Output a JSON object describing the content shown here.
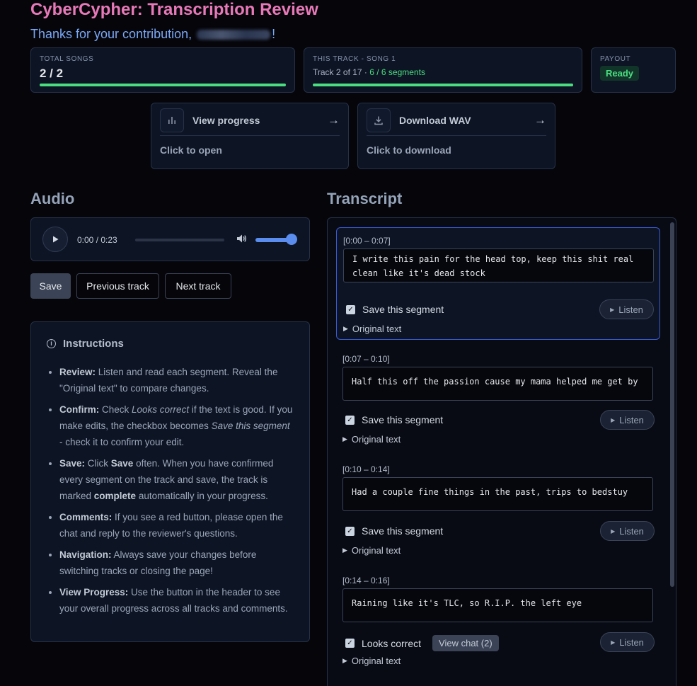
{
  "header": {
    "title": "CyberCypher: Transcription Review",
    "thanks_prefix": "Thanks for your contribution,",
    "thanks_suffix": "!"
  },
  "stats": {
    "total_songs": {
      "label": "TOTAL SONGS",
      "value": "2 / 2",
      "progress": 1.0
    },
    "this_track": {
      "label": "THIS TRACK - SONG 1",
      "track_text": "Track 2 of 17 · ",
      "segments_text": "6 / 6 segments",
      "progress": 1.0
    },
    "payout": {
      "label": "PAYOUT",
      "status": "Ready"
    }
  },
  "actions": {
    "progress": {
      "title": "View progress",
      "subtitle": "Click to open",
      "arrow": "→",
      "icon": "bar-chart-icon"
    },
    "download": {
      "title": "Download WAV",
      "subtitle": "Click to download",
      "arrow": "→",
      "icon": "download-icon"
    }
  },
  "audio": {
    "heading": "Audio",
    "time": "0:00 / 0:23",
    "volume": 1.0
  },
  "buttons": {
    "save": "Save",
    "previous": "Previous track",
    "next": "Next track"
  },
  "instructions": {
    "heading": "Instructions",
    "items": [
      {
        "key": "Review:",
        "text": " Listen and read each segment. Reveal the \"Original text\" to compare changes."
      },
      {
        "key": "Confirm:",
        "text_a": " Check ",
        "em_a": "Looks correct",
        "text_b": " if the text is good. If you make edits, the checkbox becomes ",
        "em_b": "Save this segment",
        "text_c": " - check it to confirm your edit."
      },
      {
        "key": "Save:",
        "text_a": " Click ",
        "strong_a": "Save",
        "text_b": " often. When you have confirmed every segment on the track and save, the track is marked ",
        "strong_b": "complete",
        "text_c": " automatically in your progress."
      },
      {
        "key": "Comments:",
        "text": " If you see a red button, please open the chat and reply to the reviewer's questions."
      },
      {
        "key": "Navigation:",
        "text": " Always save your changes before switching tracks or closing the page!"
      },
      {
        "key": "View Progress:",
        "text": " Use the button in the header to see your overall progress across all tracks and comments."
      }
    ]
  },
  "transcript": {
    "heading": "Transcript",
    "listen_label": "Listen",
    "original_label": "Original text",
    "segments": [
      {
        "time": "[0:00 – 0:07]",
        "text": "I write this pain for the head top, keep this shit real clean like it's dead stock",
        "checkbox_label": "Save this segment",
        "checked": true
      },
      {
        "time": "[0:07 – 0:10]",
        "text": "Half this off the passion cause my mama helped me get by",
        "checkbox_label": "Save this segment",
        "checked": true
      },
      {
        "time": "[0:10 – 0:14]",
        "text": "Had a couple fine things in the past, trips to bedstuy",
        "checkbox_label": "Save this segment",
        "checked": true
      },
      {
        "time": "[0:14 – 0:16]",
        "text": "Raining like it's TLC, so R.I.P. the left eye",
        "checkbox_label": "Looks correct",
        "checked": true,
        "chat_label": "View chat (2)"
      }
    ]
  }
}
